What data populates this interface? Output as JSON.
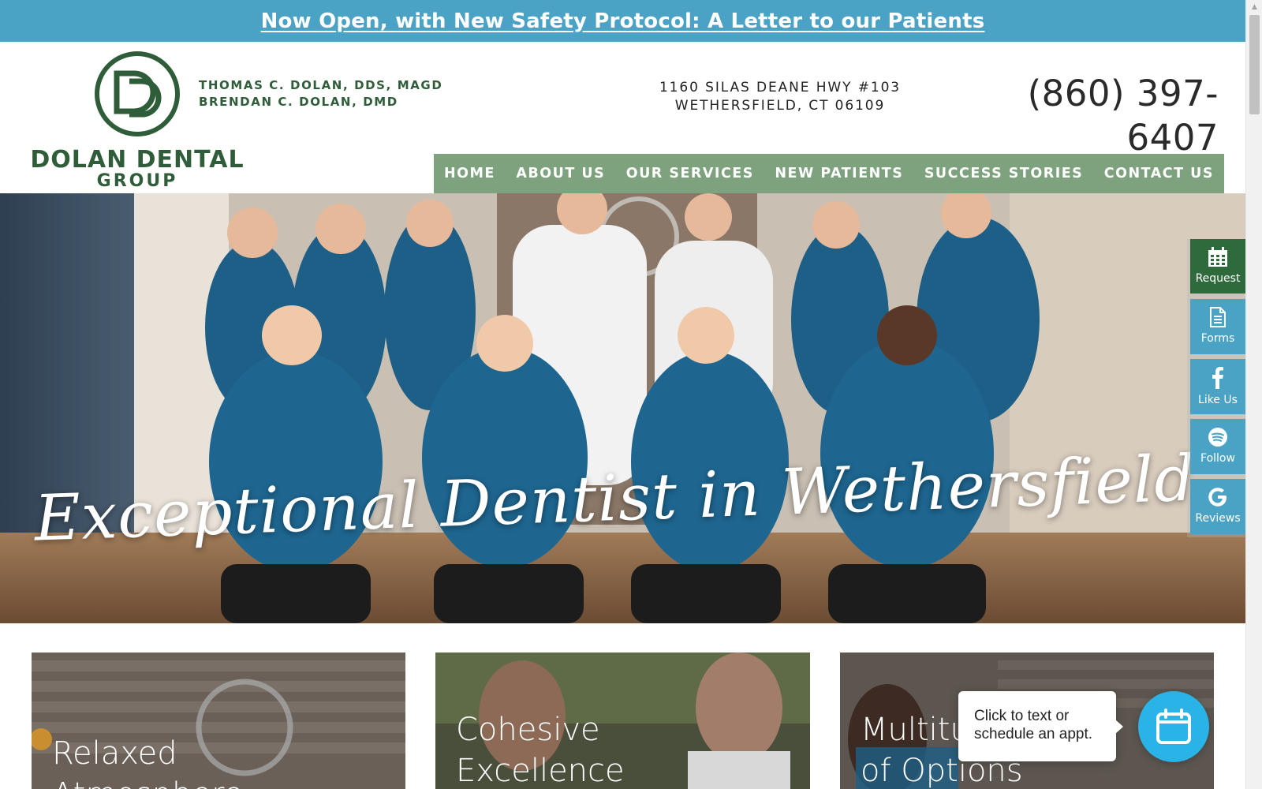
{
  "announcement": {
    "text": "Now Open, with New Safety Protocol: A Letter to our Patients"
  },
  "header": {
    "logo_name": "DOLAN DENTAL",
    "logo_group": "GROUP",
    "doctors": [
      "THOMAS C. DOLAN, DDS, MAGD",
      "BRENDAN C. DOLAN, DMD"
    ],
    "address": [
      "1160 SILAS DEANE HWY #103",
      "WETHERSFIELD, CT 06109"
    ],
    "phone": "(860) 397-6407"
  },
  "nav": {
    "items": [
      {
        "label": "HOME"
      },
      {
        "label": "ABOUT US"
      },
      {
        "label": "OUR SERVICES"
      },
      {
        "label": "NEW PATIENTS"
      },
      {
        "label": "SUCCESS STORIES"
      },
      {
        "label": "CONTACT US"
      }
    ]
  },
  "hero": {
    "title": "Exceptional Dentist in Wethersfield"
  },
  "side_buttons": [
    {
      "label": "Request",
      "icon": "calendar-icon"
    },
    {
      "label": "Forms",
      "icon": "document-icon"
    },
    {
      "label": "Like Us",
      "icon": "facebook-icon"
    },
    {
      "label": "Follow",
      "icon": "spotify-icon"
    },
    {
      "label": "Reviews",
      "icon": "google-icon"
    }
  ],
  "cards": [
    {
      "title_lines": [
        "Relaxed",
        "Atmosphere"
      ]
    },
    {
      "title_lines": [
        "Cohesive",
        "Excellence"
      ]
    },
    {
      "title_lines": [
        "Multitude",
        "of Options"
      ]
    }
  ],
  "chat": {
    "text_line1": "Click to text or",
    "text_line2": "schedule an appt.",
    "icon": "calendar-icon"
  },
  "colors": {
    "announce": "#4aa3c5",
    "brand_green": "#2f5d3a",
    "nav": "#7fa27e",
    "request_btn": "#2f6a3d",
    "chat_btn": "#2ab3e6"
  }
}
